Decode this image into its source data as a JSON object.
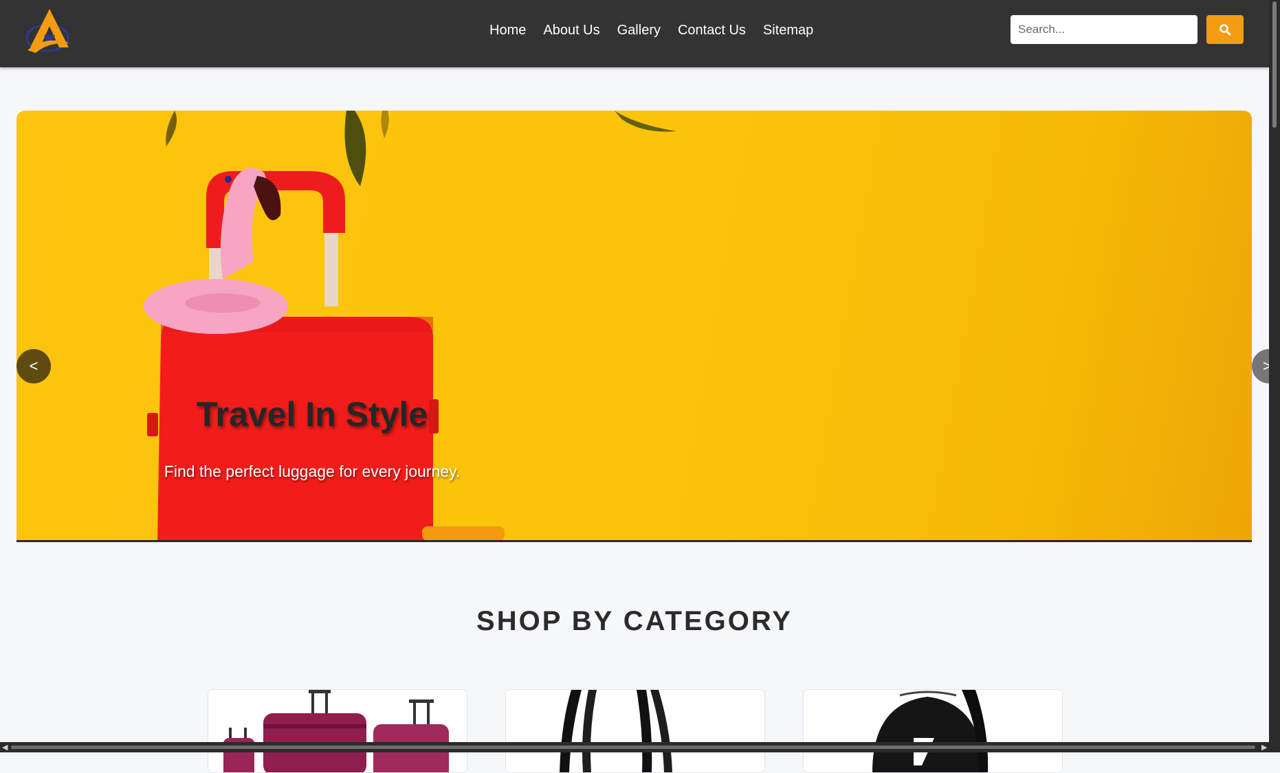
{
  "header": {
    "nav": [
      "Home",
      "About Us",
      "Gallery",
      "Contact Us",
      "Sitemap"
    ],
    "search_placeholder": "Search..."
  },
  "hero": {
    "title": "Travel In Style",
    "subtitle": "Find the perfect luggage for every journey.",
    "prev_label": "<",
    "next_label": ">"
  },
  "categories": {
    "title": "SHOP BY CATEGORY"
  },
  "colors": {
    "header_bg": "#333333",
    "accent": "#f39c12",
    "hero_bg": "#fcc50d",
    "page_bg": "#f5f7fa"
  },
  "icons": [
    "logo-icon",
    "search-icon",
    "chevron-left-icon",
    "chevron-right-icon"
  ]
}
